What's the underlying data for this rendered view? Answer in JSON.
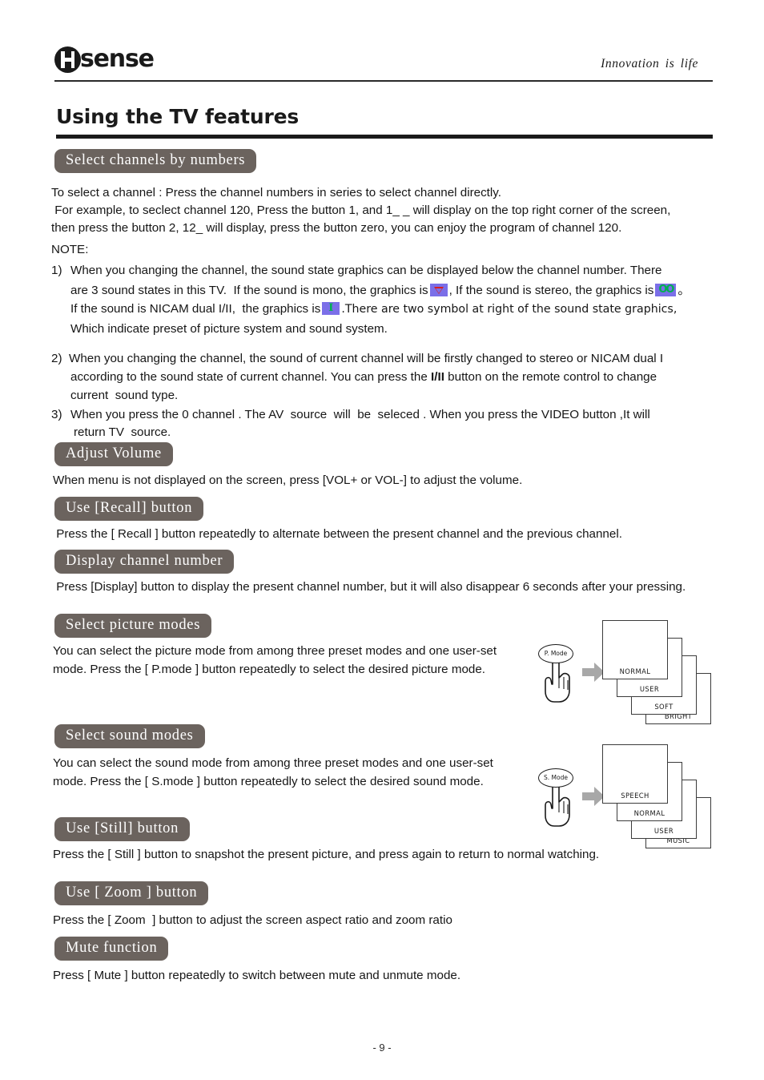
{
  "header": {
    "logo_text": "sense",
    "logo_name": "Hisense",
    "tagline": "Innovation  is  life"
  },
  "page_title": "Using the TV features",
  "sections": [
    {
      "id": "select-channels-by-numbers",
      "heading": "Select channels by numbers",
      "paragraphs": [
        "To select a channel : Press the channel numbers in series to select channel directly.",
        " For example, to seclect channel 120, Press the button 1, and 1_ _ will display on the top right corner of the screen,",
        "then press the button 2, 12_ will display, press the button zero, you can enjoy the program of channel 120."
      ],
      "note_label": "NOTE:",
      "notes": [
        {
          "marker": "1)",
          "line1": "When you changing the channel, the sound state graphics can be displayed below the channel number. There",
          "line2_a": "are 3 sound states in this TV.  If the sound is mono, the graphics is",
          "line2_b": ", If the sound is stereo, the graphics is",
          "line2_c": "。",
          "line3_a": "If the sound is NICAM dual I/II,  the graphics is",
          "line3_b": ".There are two symbol at right of the sound state graphics,",
          "line4": "Which indicate preset of picture system and sound system."
        },
        {
          "marker": "2)",
          "line1": "When you changing the channel, the sound of current channel will be firstly changed to stereo or NICAM dual I",
          "line2_a": "according to the sound state of current channel. You can press the",
          "line2_bold": "I/II",
          "line2_b": "button on the remote control to change",
          "line3": "current  sound type."
        },
        {
          "marker": "3)",
          "line1": "When you press the 0 channel . The AV  source  will  be  seleced . When you press the VIDEO button ,It will",
          "line2": "return TV  source."
        }
      ],
      "badges": {
        "mono": "triangle-down-icon",
        "stereo": "OO",
        "nicam": "I"
      }
    },
    {
      "id": "adjust-volume",
      "heading": "Adjust Volume",
      "body": "When menu is not displayed on the screen, press [VOL+ or VOL-] to adjust the volume."
    },
    {
      "id": "use-recall-button",
      "heading": "Use [Recall]  button",
      "body": " Press the [ Recall ] button repeatedly to alternate between the present channel and the previous channel."
    },
    {
      "id": "display-channel-number",
      "heading": "Display channel number",
      "body": " Press [Display] button to display the present channel number, but it will also disappear 6 seconds after your pressing."
    },
    {
      "id": "select-picture-modes",
      "heading": "Select  picture modes",
      "body_line1": "You can select the picture mode from among three preset modes and one user-set",
      "body_line2": "mode. Press the [ P.mode ] button repeatedly to select the desired picture mode.",
      "diagram": {
        "button_label": "P. Mode",
        "cards": [
          "NORMAL",
          "USER",
          "SOFT",
          "BRIGHT"
        ]
      }
    },
    {
      "id": "select-sound-modes",
      "heading": "Select  sound  modes",
      "body_line1": "You can select the sound mode from among three preset modes and one user-set",
      "body_line2": "mode. Press the [ S.mode ] button repeatedly to select the desired sound mode.",
      "diagram": {
        "button_label": "S. Mode",
        "cards": [
          "SPEECH",
          "NORMAL",
          "USER",
          "MUSIC"
        ]
      }
    },
    {
      "id": "use-still-button",
      "heading": "Use  [Still]  button",
      "body": "Press the [ Still ] button to snapshot the present picture, and press again to return to normal watching."
    },
    {
      "id": "use-zoom-button",
      "heading": "Use  [ Zoom ]  button",
      "body": "Press the [ Zoom  ] button to adjust the screen aspect ratio and zoom ratio"
    },
    {
      "id": "mute-function",
      "heading": "Mute function",
      "body": "Press [ Mute ] button repeatedly to switch between mute and unmute mode."
    }
  ],
  "footer": {
    "page_number": "- 9 -"
  },
  "colors": {
    "heading_pill": "#6b635e",
    "badge_background": "#7b6fe8",
    "badge_mono_fg": "#d81f1f",
    "badge_stereo_fg": "#00b050",
    "text": "#161616"
  }
}
